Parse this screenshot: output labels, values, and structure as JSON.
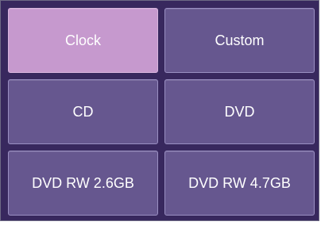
{
  "options": [
    {
      "label": "Clock",
      "selected": true
    },
    {
      "label": "Custom",
      "selected": false
    },
    {
      "label": "CD",
      "selected": false
    },
    {
      "label": "DVD",
      "selected": false
    },
    {
      "label": "DVD RW 2.6GB",
      "selected": false
    },
    {
      "label": "DVD RW 4.7GB",
      "selected": false
    }
  ],
  "colors": {
    "panel_bg": "#38285e",
    "button_bg": "#66578f",
    "button_selected_bg": "#c699ce",
    "text": "#ffffff"
  }
}
